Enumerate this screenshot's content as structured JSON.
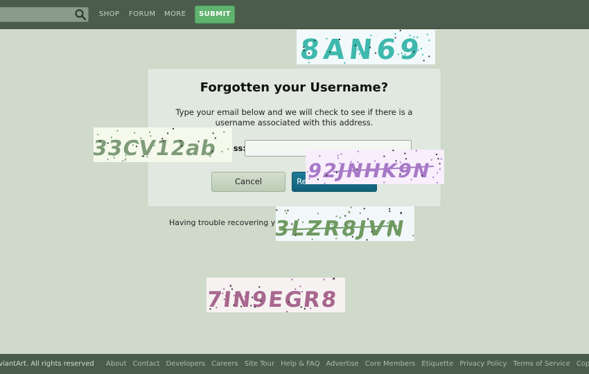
{
  "nav": {
    "items": [
      "SHOP",
      "FORUM",
      "MORE"
    ],
    "submit_label": "SUBMIT"
  },
  "dialog": {
    "title": "Forgotten your Username?",
    "description": "Type your email below and we will check to see if there is a username associated with this address.",
    "email_label": "ss:",
    "email_value": "",
    "cancel_label": "Cancel",
    "recover_label": "Recover Username"
  },
  "help": {
    "text": "Having trouble recovering you",
    "link": "k"
  },
  "captchas": [
    {
      "text": "8AN69",
      "color": "#3fb8ad",
      "bg": "#f2f9fb"
    },
    {
      "text": "33CV12ab",
      "color": "#7f9c78",
      "bg": "#f5f9ec"
    },
    {
      "text": "92JNHK9N",
      "color": "#a779c7",
      "bg": "#f8eefc"
    },
    {
      "text": "3LZR8JVN",
      "color": "#6f9a62",
      "bg": "#f2f7fa"
    },
    {
      "text": "7IN9EGR8",
      "color": "#a8678e",
      "bg": "#f7f2f2"
    }
  ],
  "footer": {
    "copyright": "viantArt. All rights reserved",
    "links": [
      "About",
      "Contact",
      "Developers",
      "Careers",
      "Site Tour",
      "Help & FAQ",
      "Advertise",
      "Core Members",
      "Etiquette",
      "Privacy Policy",
      "Terms of Service",
      "Copyr"
    ]
  },
  "colors": {
    "background": "#cfdacb",
    "topbar": "#4b5c4d",
    "submit": "#5fb36f",
    "recover": "#12607a",
    "link": "#2a8a88"
  }
}
